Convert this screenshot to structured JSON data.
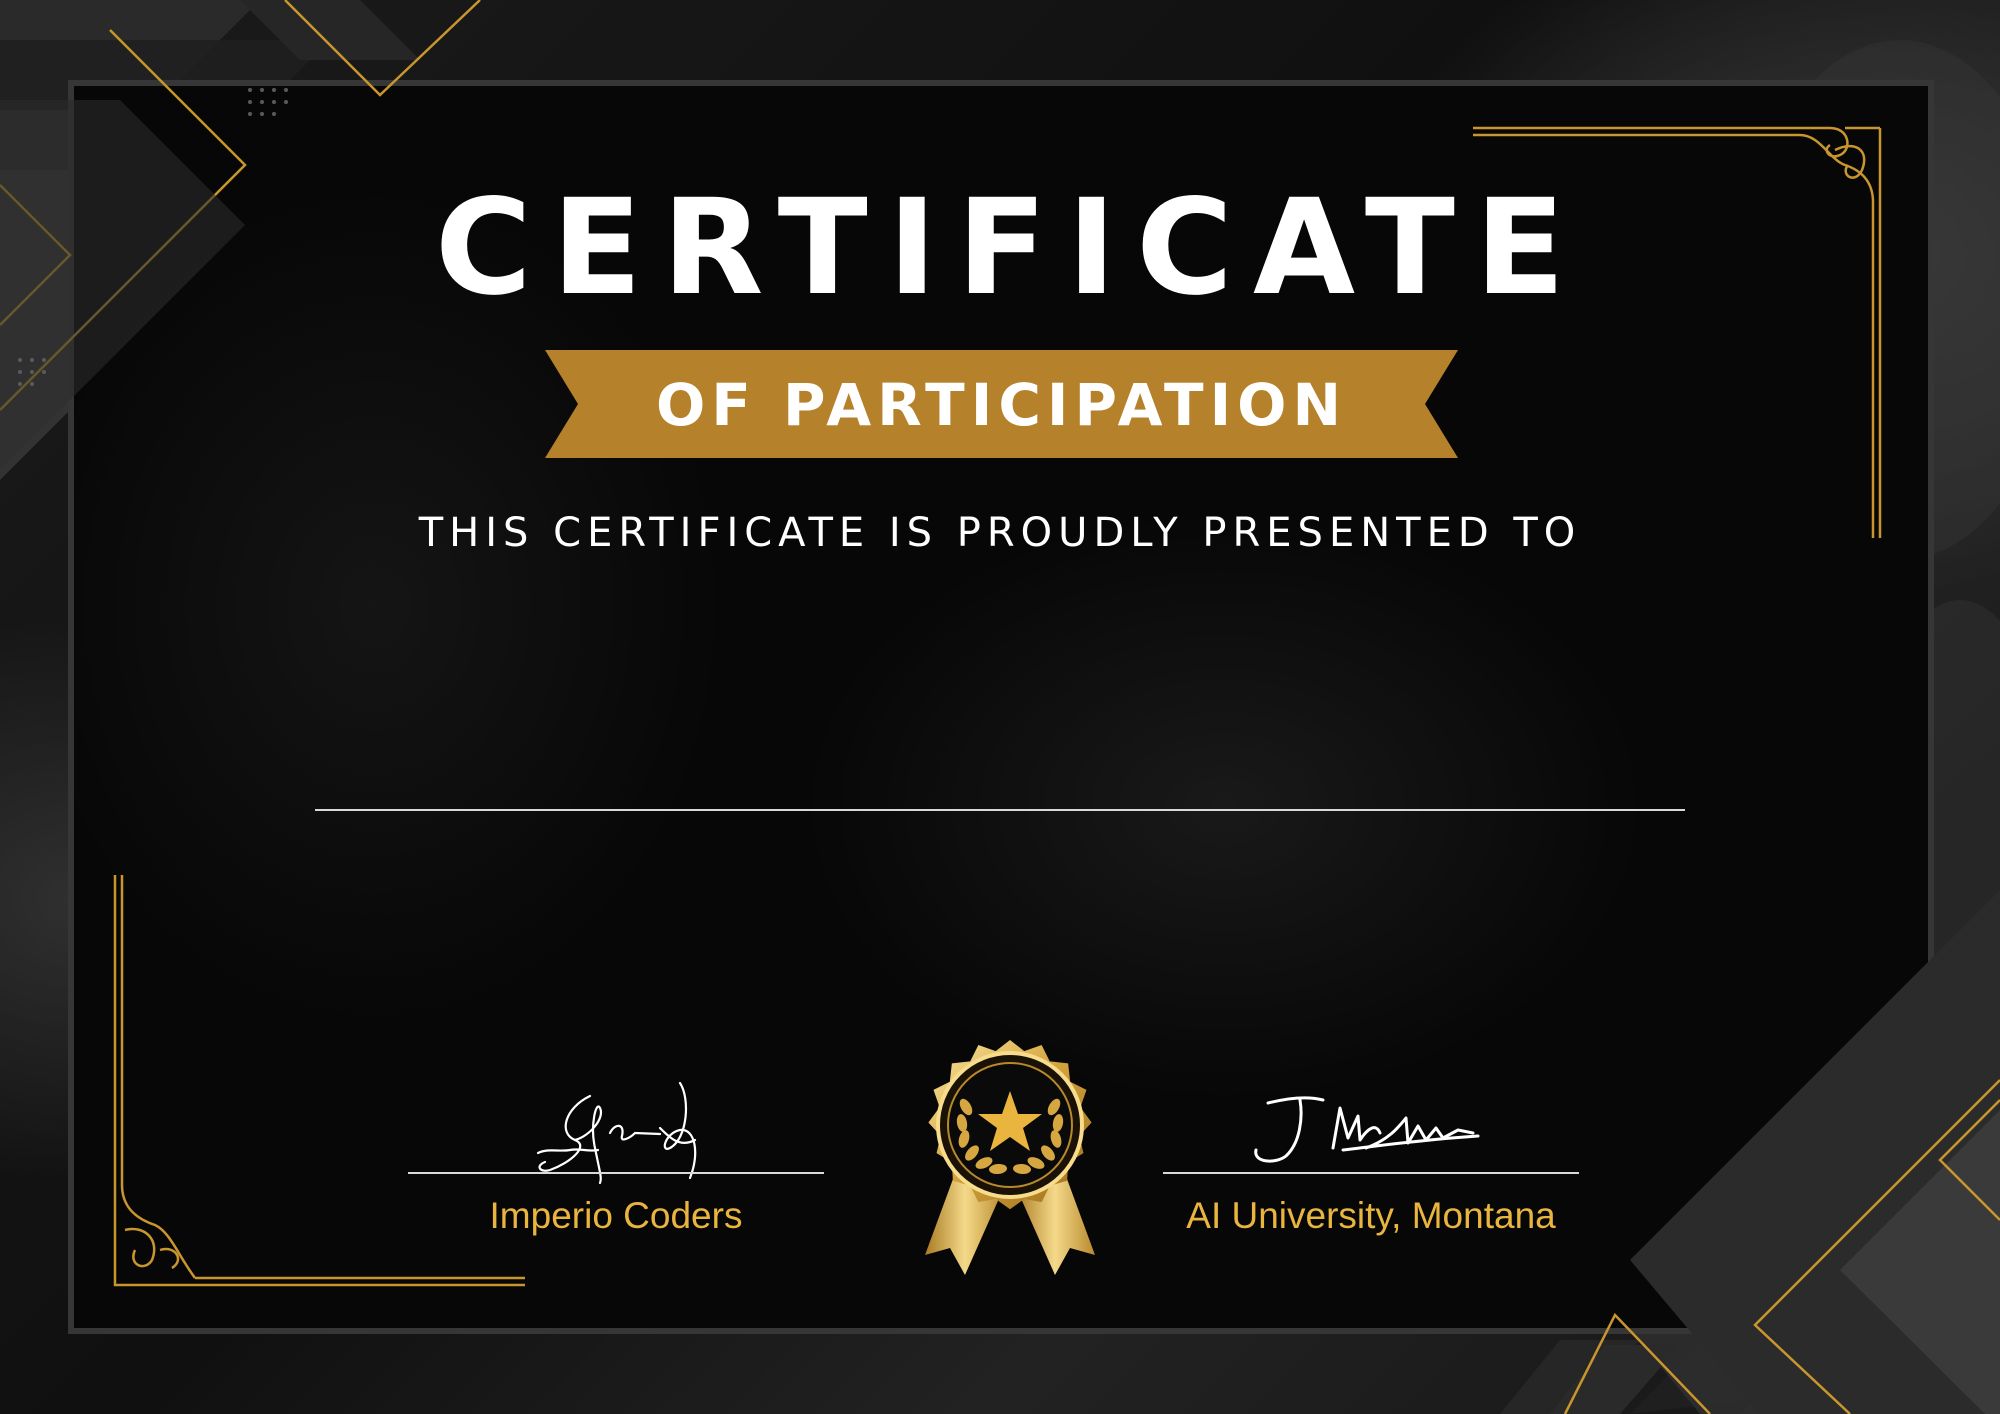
{
  "certificate": {
    "title": "CERTIFICATE",
    "subtitle": "OF PARTICIPATION",
    "presented_text": "THIS CERTIFICATE IS PROUDLY PRESENTED TO",
    "recipient_name": ""
  },
  "signatures": {
    "left": {
      "name": "Imperio Coders"
    },
    "right": {
      "name": "AI University, Montana"
    }
  },
  "colors": {
    "gold": "#b5812a",
    "gold_text": "#e9b53f",
    "panel": "#070707",
    "text": "#ffffff"
  }
}
